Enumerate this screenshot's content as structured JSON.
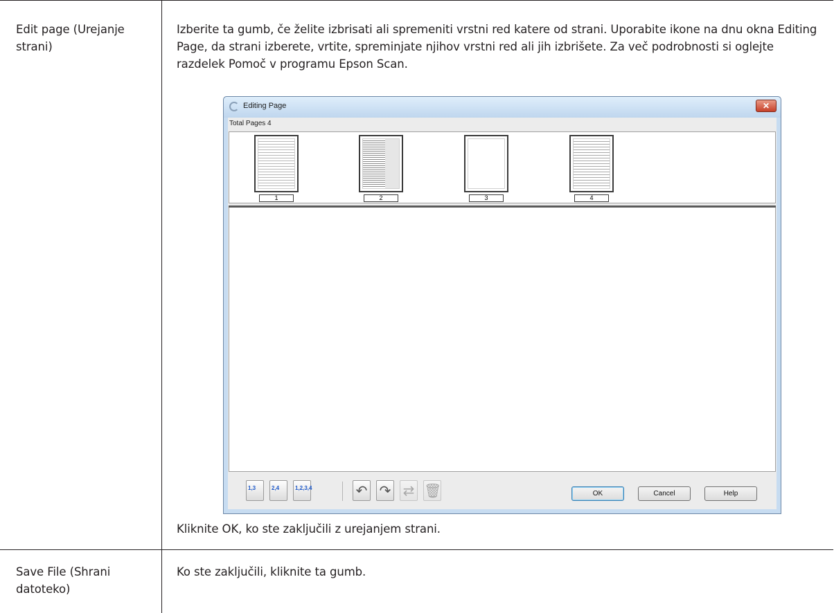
{
  "rows": [
    {
      "term": "Edit page (Urejanje strani)",
      "description": "Izberite ta gumb, če želite izbrisati ali spremeniti vrstni red katere od strani. Uporabite ikone na dnu okna Editing Page, da strani izberete, vrtite, spreminjate njihov vrstni red ali jih izbrišete. Za več podrobnosti si oglejte razdelek Pomoč v programu Epson Scan.",
      "note": "Kliknite OK, ko ste zaključili z urejanjem strani."
    },
    {
      "term": "Save File (Shrani datoteko)",
      "description": "Ko ste zaključili, kliknite ta gumb."
    }
  ],
  "dialog": {
    "title": "Editing Page",
    "close_glyph": "✕",
    "total_pages_label": "Total Pages 4",
    "pages": [
      "1",
      "2",
      "3",
      "4"
    ],
    "toolbar_icons": [
      {
        "name": "select-odd-pages-icon",
        "label": "1,3"
      },
      {
        "name": "select-even-pages-icon",
        "label": "2,4"
      },
      {
        "name": "select-all-pages-icon",
        "label": "1,2,3,4"
      },
      {
        "name": "rotate-left-icon",
        "label": ""
      },
      {
        "name": "rotate-right-icon",
        "label": ""
      },
      {
        "name": "move-page-icon",
        "label": ""
      },
      {
        "name": "delete-page-icon",
        "label": ""
      }
    ],
    "buttons": {
      "ok": "OK",
      "cancel": "Cancel",
      "help": "Help"
    }
  }
}
